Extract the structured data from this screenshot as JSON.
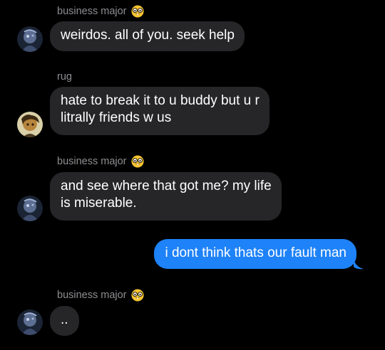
{
  "thread": {
    "messages": [
      {
        "sender": "business major",
        "emoji": "nerd-face-icon",
        "lines": [
          "weirdos. all of you. seek help"
        ]
      },
      {
        "sender": "rug",
        "lines": [
          "hate to break it to u buddy but u r",
          "litrally friends w us"
        ]
      },
      {
        "sender": "business major",
        "emoji": "nerd-face-icon",
        "lines": [
          "and see where that got me? my life",
          "is miserable."
        ]
      },
      {
        "sender": "me",
        "lines": [
          "i dont think thats our fault man"
        ]
      },
      {
        "sender": "business major",
        "emoji": "nerd-face-icon",
        "lines": [
          ".."
        ]
      }
    ]
  },
  "colors": {
    "background": "#000000",
    "incoming_bubble": "#262629",
    "outgoing_bubble": "#1e82f8",
    "sender_name": "#8e8e93",
    "text": "#ffffff"
  }
}
